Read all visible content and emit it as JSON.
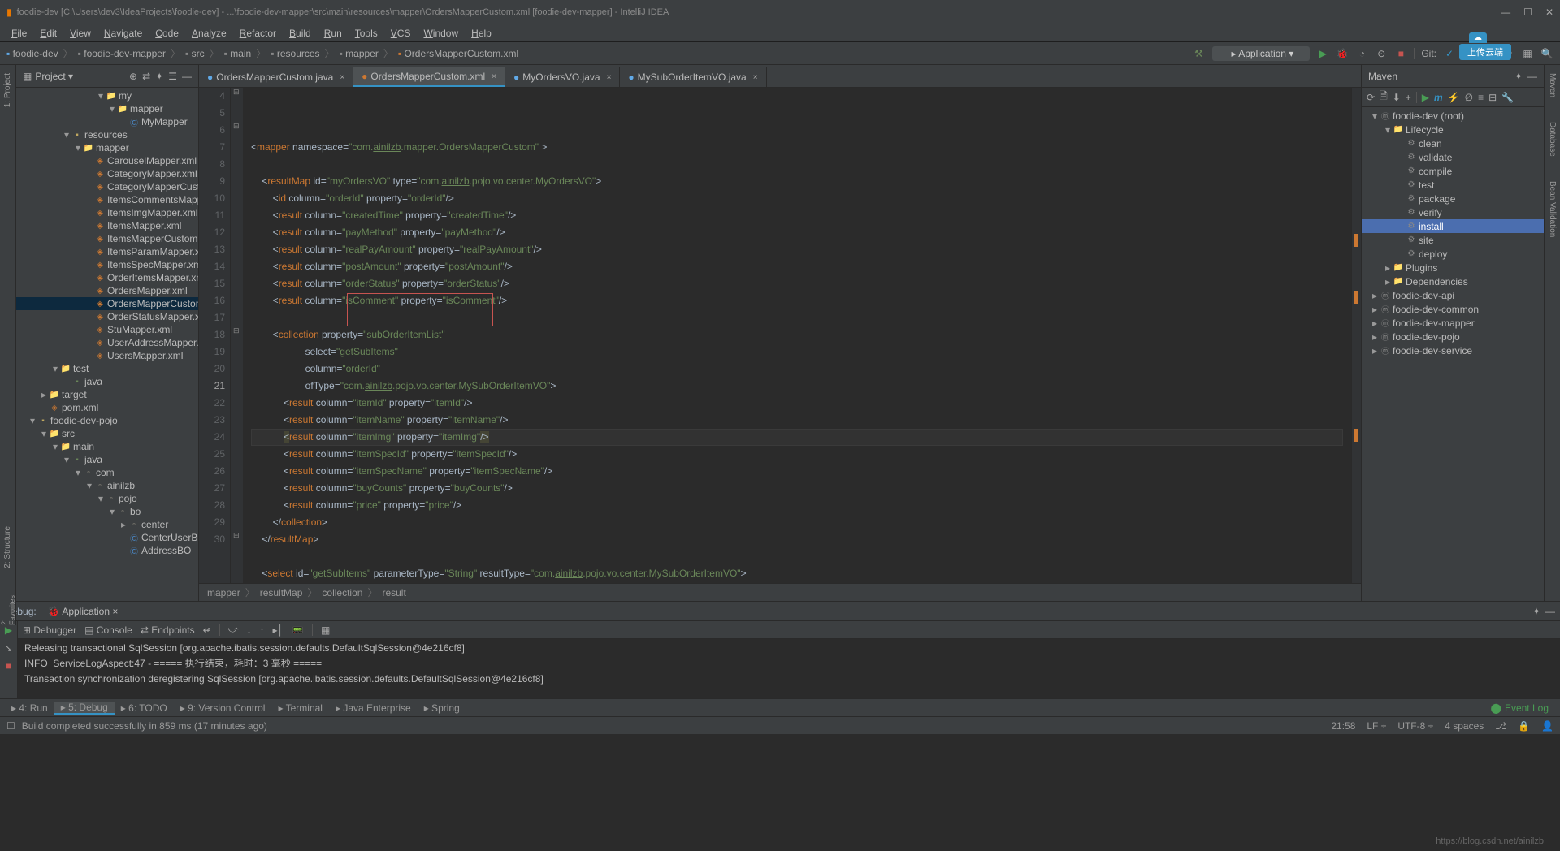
{
  "title": "foodie-dev [C:\\Users\\dev3\\IdeaProjects\\foodie-dev] - ...\\foodie-dev-mapper\\src\\main\\resources\\mapper\\OrdersMapperCustom.xml [foodie-dev-mapper] - IntelliJ IDEA",
  "menu": [
    "File",
    "Edit",
    "View",
    "Navigate",
    "Code",
    "Analyze",
    "Refactor",
    "Build",
    "Run",
    "Tools",
    "VCS",
    "Window",
    "Help"
  ],
  "breadcrumbs": [
    "foodie-dev",
    "foodie-dev-mapper",
    "src",
    "main",
    "resources",
    "mapper",
    "OrdersMapperCustom.xml"
  ],
  "runConfig": "Application",
  "cloud": "上传云端",
  "projectTitle": "Project",
  "tree": {
    "items": [
      {
        "depth": 7,
        "arrow": "▾",
        "icon": "folder",
        "label": "my"
      },
      {
        "depth": 8,
        "arrow": "▾",
        "icon": "folder",
        "label": "mapper"
      },
      {
        "depth": 9,
        "arrow": "",
        "icon": "cls",
        "label": "MyMapper"
      },
      {
        "depth": 4,
        "arrow": "▾",
        "icon": "resources",
        "label": "resources"
      },
      {
        "depth": 5,
        "arrow": "▾",
        "icon": "folder",
        "label": "mapper"
      },
      {
        "depth": 6,
        "arrow": "",
        "icon": "xml",
        "label": "CarouselMapper.xml"
      },
      {
        "depth": 6,
        "arrow": "",
        "icon": "xml",
        "label": "CategoryMapper.xml"
      },
      {
        "depth": 6,
        "arrow": "",
        "icon": "xml",
        "label": "CategoryMapperCustom.x"
      },
      {
        "depth": 6,
        "arrow": "",
        "icon": "xml",
        "label": "ItemsCommentsMapper.x"
      },
      {
        "depth": 6,
        "arrow": "",
        "icon": "xml",
        "label": "ItemsImgMapper.xml"
      },
      {
        "depth": 6,
        "arrow": "",
        "icon": "xml",
        "label": "ItemsMapper.xml"
      },
      {
        "depth": 6,
        "arrow": "",
        "icon": "xml",
        "label": "ItemsMapperCustom.xml"
      },
      {
        "depth": 6,
        "arrow": "",
        "icon": "xml",
        "label": "ItemsParamMapper.xml"
      },
      {
        "depth": 6,
        "arrow": "",
        "icon": "xml",
        "label": "ItemsSpecMapper.xml"
      },
      {
        "depth": 6,
        "arrow": "",
        "icon": "xml",
        "label": "OrderItemsMapper.xml"
      },
      {
        "depth": 6,
        "arrow": "",
        "icon": "xml",
        "label": "OrdersMapper.xml"
      },
      {
        "depth": 6,
        "arrow": "",
        "icon": "xml",
        "label": "OrdersMapperCustom.xm",
        "selected": true
      },
      {
        "depth": 6,
        "arrow": "",
        "icon": "xml",
        "label": "OrderStatusMapper.xml"
      },
      {
        "depth": 6,
        "arrow": "",
        "icon": "xml",
        "label": "StuMapper.xml"
      },
      {
        "depth": 6,
        "arrow": "",
        "icon": "xml",
        "label": "UserAddressMapper.xml"
      },
      {
        "depth": 6,
        "arrow": "",
        "icon": "xml",
        "label": "UsersMapper.xml"
      },
      {
        "depth": 3,
        "arrow": "▾",
        "icon": "folder",
        "label": "test"
      },
      {
        "depth": 4,
        "arrow": "",
        "icon": "java",
        "label": "java"
      },
      {
        "depth": 2,
        "arrow": "▸",
        "icon": "folder",
        "label": "target"
      },
      {
        "depth": 2,
        "arrow": "",
        "icon": "xml",
        "label": "pom.xml"
      },
      {
        "depth": 1,
        "arrow": "▾",
        "icon": "module",
        "label": "foodie-dev-pojo"
      },
      {
        "depth": 2,
        "arrow": "▾",
        "icon": "folder",
        "label": "src"
      },
      {
        "depth": 3,
        "arrow": "▾",
        "icon": "folder",
        "label": "main"
      },
      {
        "depth": 4,
        "arrow": "▾",
        "icon": "java",
        "label": "java"
      },
      {
        "depth": 5,
        "arrow": "▾",
        "icon": "pkg",
        "label": "com"
      },
      {
        "depth": 6,
        "arrow": "▾",
        "icon": "pkg",
        "label": "ainilzb"
      },
      {
        "depth": 7,
        "arrow": "▾",
        "icon": "pkg",
        "label": "pojo"
      },
      {
        "depth": 8,
        "arrow": "▾",
        "icon": "pkg",
        "label": "bo"
      },
      {
        "depth": 9,
        "arrow": "▸",
        "icon": "pkg",
        "label": "center"
      },
      {
        "depth": 9,
        "arrow": "",
        "icon": "cls",
        "label": "CenterUserB"
      },
      {
        "depth": 9,
        "arrow": "",
        "icon": "cls",
        "label": "AddressBO"
      }
    ]
  },
  "tabs": [
    {
      "label": "OrdersMapperCustom.java",
      "icon": "c"
    },
    {
      "label": "OrdersMapperCustom.xml",
      "icon": "x",
      "active": true
    },
    {
      "label": "MyOrdersVO.java",
      "icon": "c"
    },
    {
      "label": "MySubOrderItemVO.java",
      "icon": "c"
    }
  ],
  "gutterStart": 4,
  "gutterEnd": 30,
  "currentLine": 21,
  "breadbar": [
    "mapper",
    "resultMap",
    "collection",
    "result"
  ],
  "mavenTitle": "Maven",
  "maven": [
    {
      "depth": 0,
      "arrow": "▾",
      "icon": "m",
      "label": "foodie-dev (root)"
    },
    {
      "depth": 1,
      "arrow": "▾",
      "icon": "f",
      "label": "Lifecycle"
    },
    {
      "depth": 2,
      "icon": "gear",
      "label": "clean"
    },
    {
      "depth": 2,
      "icon": "gear",
      "label": "validate"
    },
    {
      "depth": 2,
      "icon": "gear",
      "label": "compile"
    },
    {
      "depth": 2,
      "icon": "gear",
      "label": "test"
    },
    {
      "depth": 2,
      "icon": "gear",
      "label": "package"
    },
    {
      "depth": 2,
      "icon": "gear",
      "label": "verify"
    },
    {
      "depth": 2,
      "icon": "gear",
      "label": "install",
      "selected": true
    },
    {
      "depth": 2,
      "icon": "gear",
      "label": "site"
    },
    {
      "depth": 2,
      "icon": "gear",
      "label": "deploy"
    },
    {
      "depth": 1,
      "arrow": "▸",
      "icon": "f",
      "label": "Plugins"
    },
    {
      "depth": 1,
      "arrow": "▸",
      "icon": "f",
      "label": "Dependencies"
    },
    {
      "depth": 0,
      "arrow": "▸",
      "icon": "m",
      "label": "foodie-dev-api"
    },
    {
      "depth": 0,
      "arrow": "▸",
      "icon": "m",
      "label": "foodie-dev-common"
    },
    {
      "depth": 0,
      "arrow": "▸",
      "icon": "m",
      "label": "foodie-dev-mapper"
    },
    {
      "depth": 0,
      "arrow": "▸",
      "icon": "m",
      "label": "foodie-dev-pojo"
    },
    {
      "depth": 0,
      "arrow": "▸",
      "icon": "m",
      "label": "foodie-dev-service"
    }
  ],
  "debugLabel": "Debug:",
  "debugApp": "Application",
  "debuggerTab": "Debugger",
  "consoleTab": "Console",
  "endpointsTab": "Endpoints",
  "console": [
    "Releasing transactional SqlSession [org.apache.ibatis.session.defaults.DefaultSqlSession@4e216cf8]",
    "INFO  ServiceLogAspect:47 - ===== 执行结束，耗时：3 毫秒 =====",
    "Transaction synchronization deregistering SqlSession [org.apache.ibatis.session.defaults.DefaultSqlSession@4e216cf8]"
  ],
  "statusItems": [
    "4: Run",
    "5: Debug",
    "6: TODO",
    "9: Version Control",
    "Terminal",
    "Java Enterprise",
    "Spring"
  ],
  "statusActive": "5: Debug",
  "eventLog": "Event Log",
  "buildMsg": "Build completed successfully in 859 ms (17 minutes ago)",
  "cursor": "21:58",
  "lineEnd": "LF",
  "encoding": "UTF-8",
  "spaces": "4 spaces",
  "git": "Git:",
  "watermark": "https://blog.csdn.net/ainilzb"
}
